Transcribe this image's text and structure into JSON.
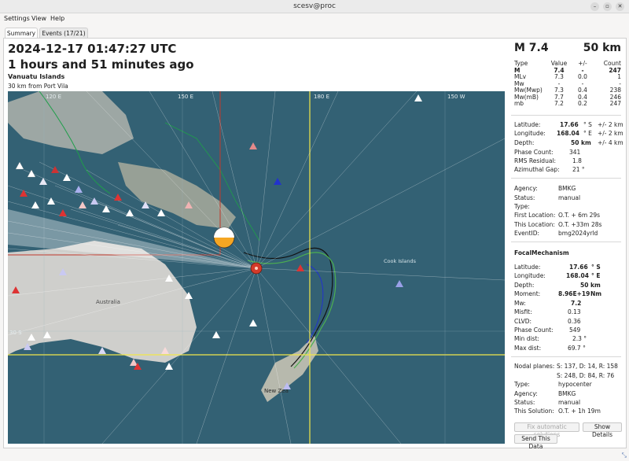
{
  "window": {
    "title": "scesv@proc",
    "min": "–",
    "max": "▫",
    "close": "✕"
  },
  "menu": [
    "Settings",
    "View",
    "Help"
  ],
  "tabs": [
    {
      "label": "Summary"
    },
    {
      "label": "Events (17/21)"
    }
  ],
  "summary": {
    "time": "2024-12-17 01:47:27 UTC",
    "ago": "1 hours and 51 minutes ago",
    "region": "Vanuatu Islands",
    "nearby": "30 km from Port Vila"
  },
  "map": {
    "grid_labels": [
      "120 E",
      "150 E",
      "180 E",
      "150 W",
      "30 S"
    ],
    "place_labels": [
      "Australia",
      "New Zea",
      "Cook Islands"
    ],
    "colors": {
      "ocean": "#2f5d70",
      "land": "#c9c9c4",
      "event": "#d33b2a",
      "grid_yellow": "#f2e84a",
      "grid_red": "#c0392b"
    }
  },
  "magnitude": {
    "label": "M 7.4",
    "depth": "50 km",
    "table_headers": [
      "Type",
      "Value",
      "+/-",
      "Count"
    ],
    "rows": [
      {
        "type": "M",
        "value": "7.4",
        "err": "-",
        "count": "247",
        "bold": true
      },
      {
        "type": "MLv",
        "value": "7.3",
        "err": "0.0",
        "count": "1"
      },
      {
        "type": "Mw",
        "value": "-",
        "err": "-",
        "count": "-"
      },
      {
        "type": "Mw(Mwp)",
        "value": "7.3",
        "err": "0.4",
        "count": "238"
      },
      {
        "type": "Mw(mB)",
        "value": "7.7",
        "err": "0.4",
        "count": "246"
      },
      {
        "type": "mb",
        "value": "7.2",
        "err": "0.2",
        "count": "247"
      }
    ]
  },
  "origin": {
    "lat_label": "Latitude:",
    "lat": "17.66",
    "lat_unit": "° S",
    "lat_err": "+/-  2 km",
    "lon_label": "Longitude:",
    "lon": "168.04",
    "lon_unit": "° E",
    "lon_err": "+/-  2 km",
    "depth_label": "Depth:",
    "depth": "50",
    "depth_unit": "km",
    "depth_err": "+/-  4 km",
    "phase_label": "Phase Count:",
    "phase": "341",
    "rms_label": "RMS Residual:",
    "rms": "1.8",
    "gap_label": "Azimuthal Gap:",
    "gap": "21 °"
  },
  "agency_block": {
    "agency_label": "Agency:",
    "agency": "BMKG",
    "status_label": "Status:",
    "status": "manual",
    "type_label": "Type:",
    "type": "",
    "first_label": "First Location:",
    "first": "O.T. + 6m 29s",
    "this_label": "This Location:",
    "this": "O.T. +33m 28s",
    "eventid_label": "EventID:",
    "eventid": "bmg2024yrld"
  },
  "focal": {
    "title": "FocalMechanism",
    "lat_label": "Latitude:",
    "lat": "17.66",
    "lat_unit": "° S",
    "lon_label": "Longitude:",
    "lon": "168.04",
    "lon_unit": "° E",
    "depth_label": "Depth:",
    "depth": "50",
    "depth_unit": "km",
    "moment_label": "Moment:",
    "moment": "8.96E+19",
    "moment_unit": "Nm",
    "mw_label": "Mw:",
    "mw": "7.2",
    "misfit_label": "Misfit:",
    "misfit": "0.13",
    "clvd_label": "CLVD:",
    "clvd": "0.36",
    "phase_label": "Phase Count:",
    "phase": "549",
    "mindist_label": "Min dist:",
    "mindist": "2.3 °",
    "maxdist_label": "Max dist:",
    "maxdist": "69.7 °",
    "nodal_label": "Nodal planes:",
    "nodal1": "S: 137, D: 14, R: 158",
    "nodal2": "S: 248, D: 84, R: 76",
    "type_label": "Type:",
    "type": "hypocenter",
    "agency_label": "Agency:",
    "agency": "BMKG",
    "status_label": "Status:",
    "status": "manual",
    "solution_label": "This Solution:",
    "solution": "O.T. + 1h 19m"
  },
  "buttons": {
    "fix": "Fix automatic solutions",
    "details": "Show Details",
    "send": "Send This Data"
  }
}
